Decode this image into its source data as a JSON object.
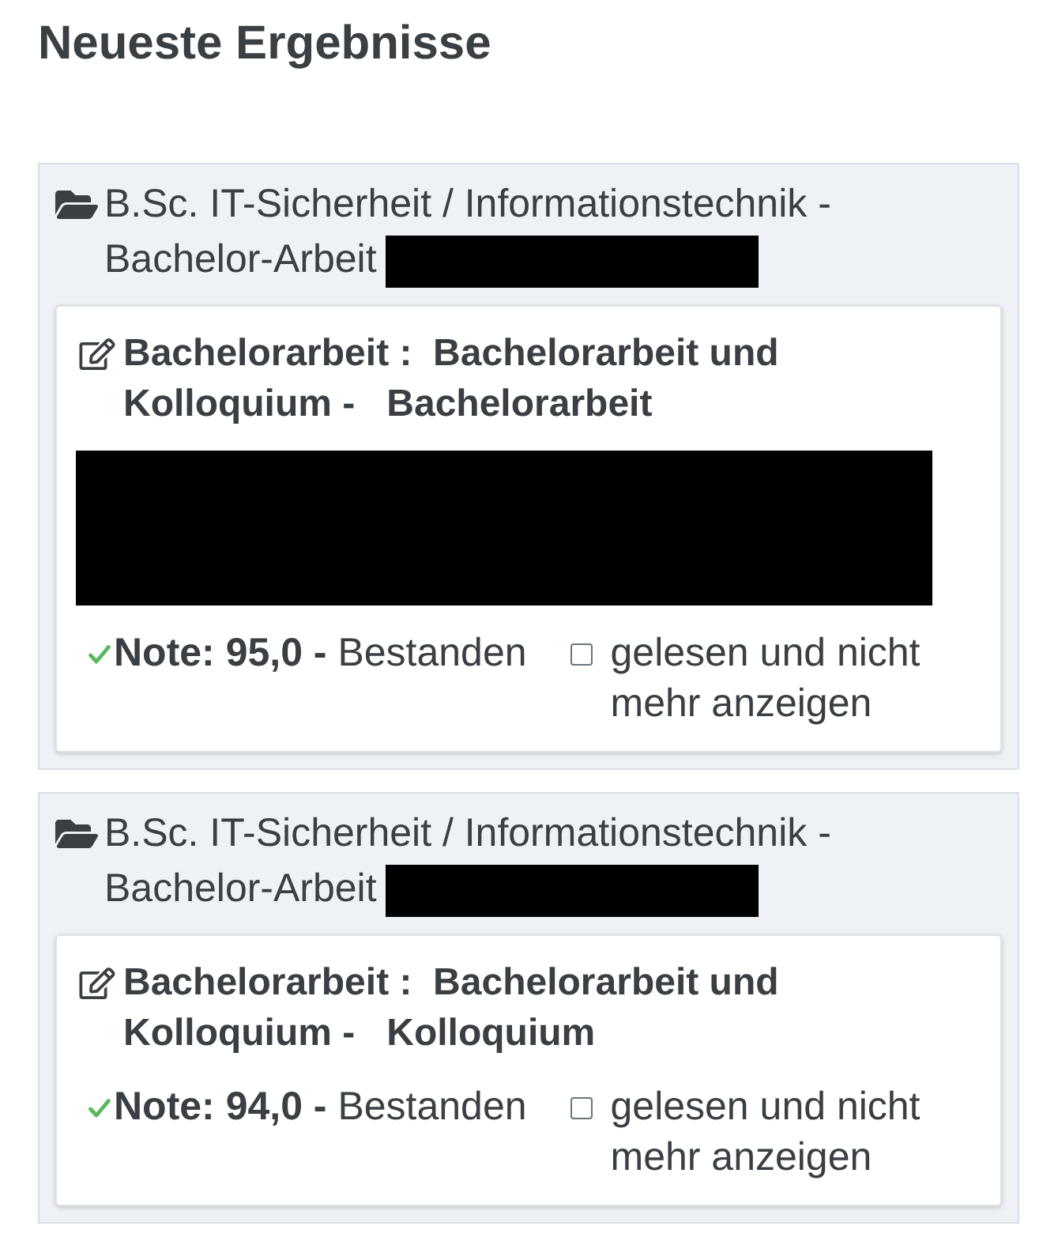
{
  "heading": "Neueste Ergebnisse",
  "results": [
    {
      "program": "B.Sc. IT-Sicherheit / Informationstechnik - Bachelor-Arbeit",
      "program_redacted": true,
      "title": "Bachelorarbeit :  Bachelorarbeit und Kolloquium -   Bachelorarbeit",
      "details_redacted": true,
      "passed": true,
      "note": "**Note: 95,0 -** Bestanden",
      "hide_checkbox": {
        "label": "gelesen und nicht mehr anzeigen",
        "checked": false
      }
    },
    {
      "program": "B.Sc. IT-Sicherheit / Informationstechnik - Bachelor-Arbeit",
      "program_redacted": true,
      "title": "Bachelorarbeit :  Bachelorarbeit und Kolloquium -   Kolloquium",
      "details_redacted": false,
      "passed": true,
      "note": "**Note: 94,0 -** Bestanden",
      "hide_checkbox": {
        "label": "gelesen und nicht mehr anzeigen",
        "checked": false
      }
    }
  ]
}
